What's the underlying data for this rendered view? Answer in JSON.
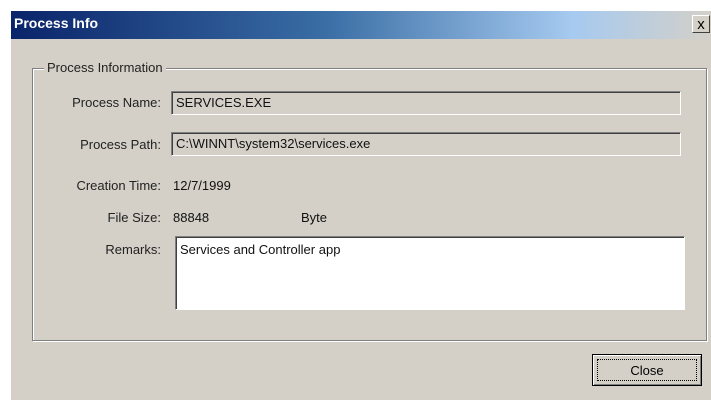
{
  "window": {
    "title": "Process Info",
    "close_glyph": "x"
  },
  "group": {
    "legend": "Process Information"
  },
  "fields": {
    "process_name_label": "Process Name:",
    "process_name_value": "SERVICES.EXE",
    "process_path_label": "Process Path:",
    "process_path_value": "C:\\WINNT\\system32\\services.exe",
    "creation_time_label": "Creation Time:",
    "creation_time_value": "12/7/1999",
    "file_size_label": "File Size:",
    "file_size_value": "88848",
    "file_size_unit": "Byte",
    "remarks_label": "Remarks:",
    "remarks_value": "Services and Controller app"
  },
  "buttons": {
    "close_label": "Close"
  },
  "colors": {
    "dialog_face": "#d4d0c8",
    "titlebar_start": "#0a246a",
    "titlebar_end": "#a6caf0"
  }
}
